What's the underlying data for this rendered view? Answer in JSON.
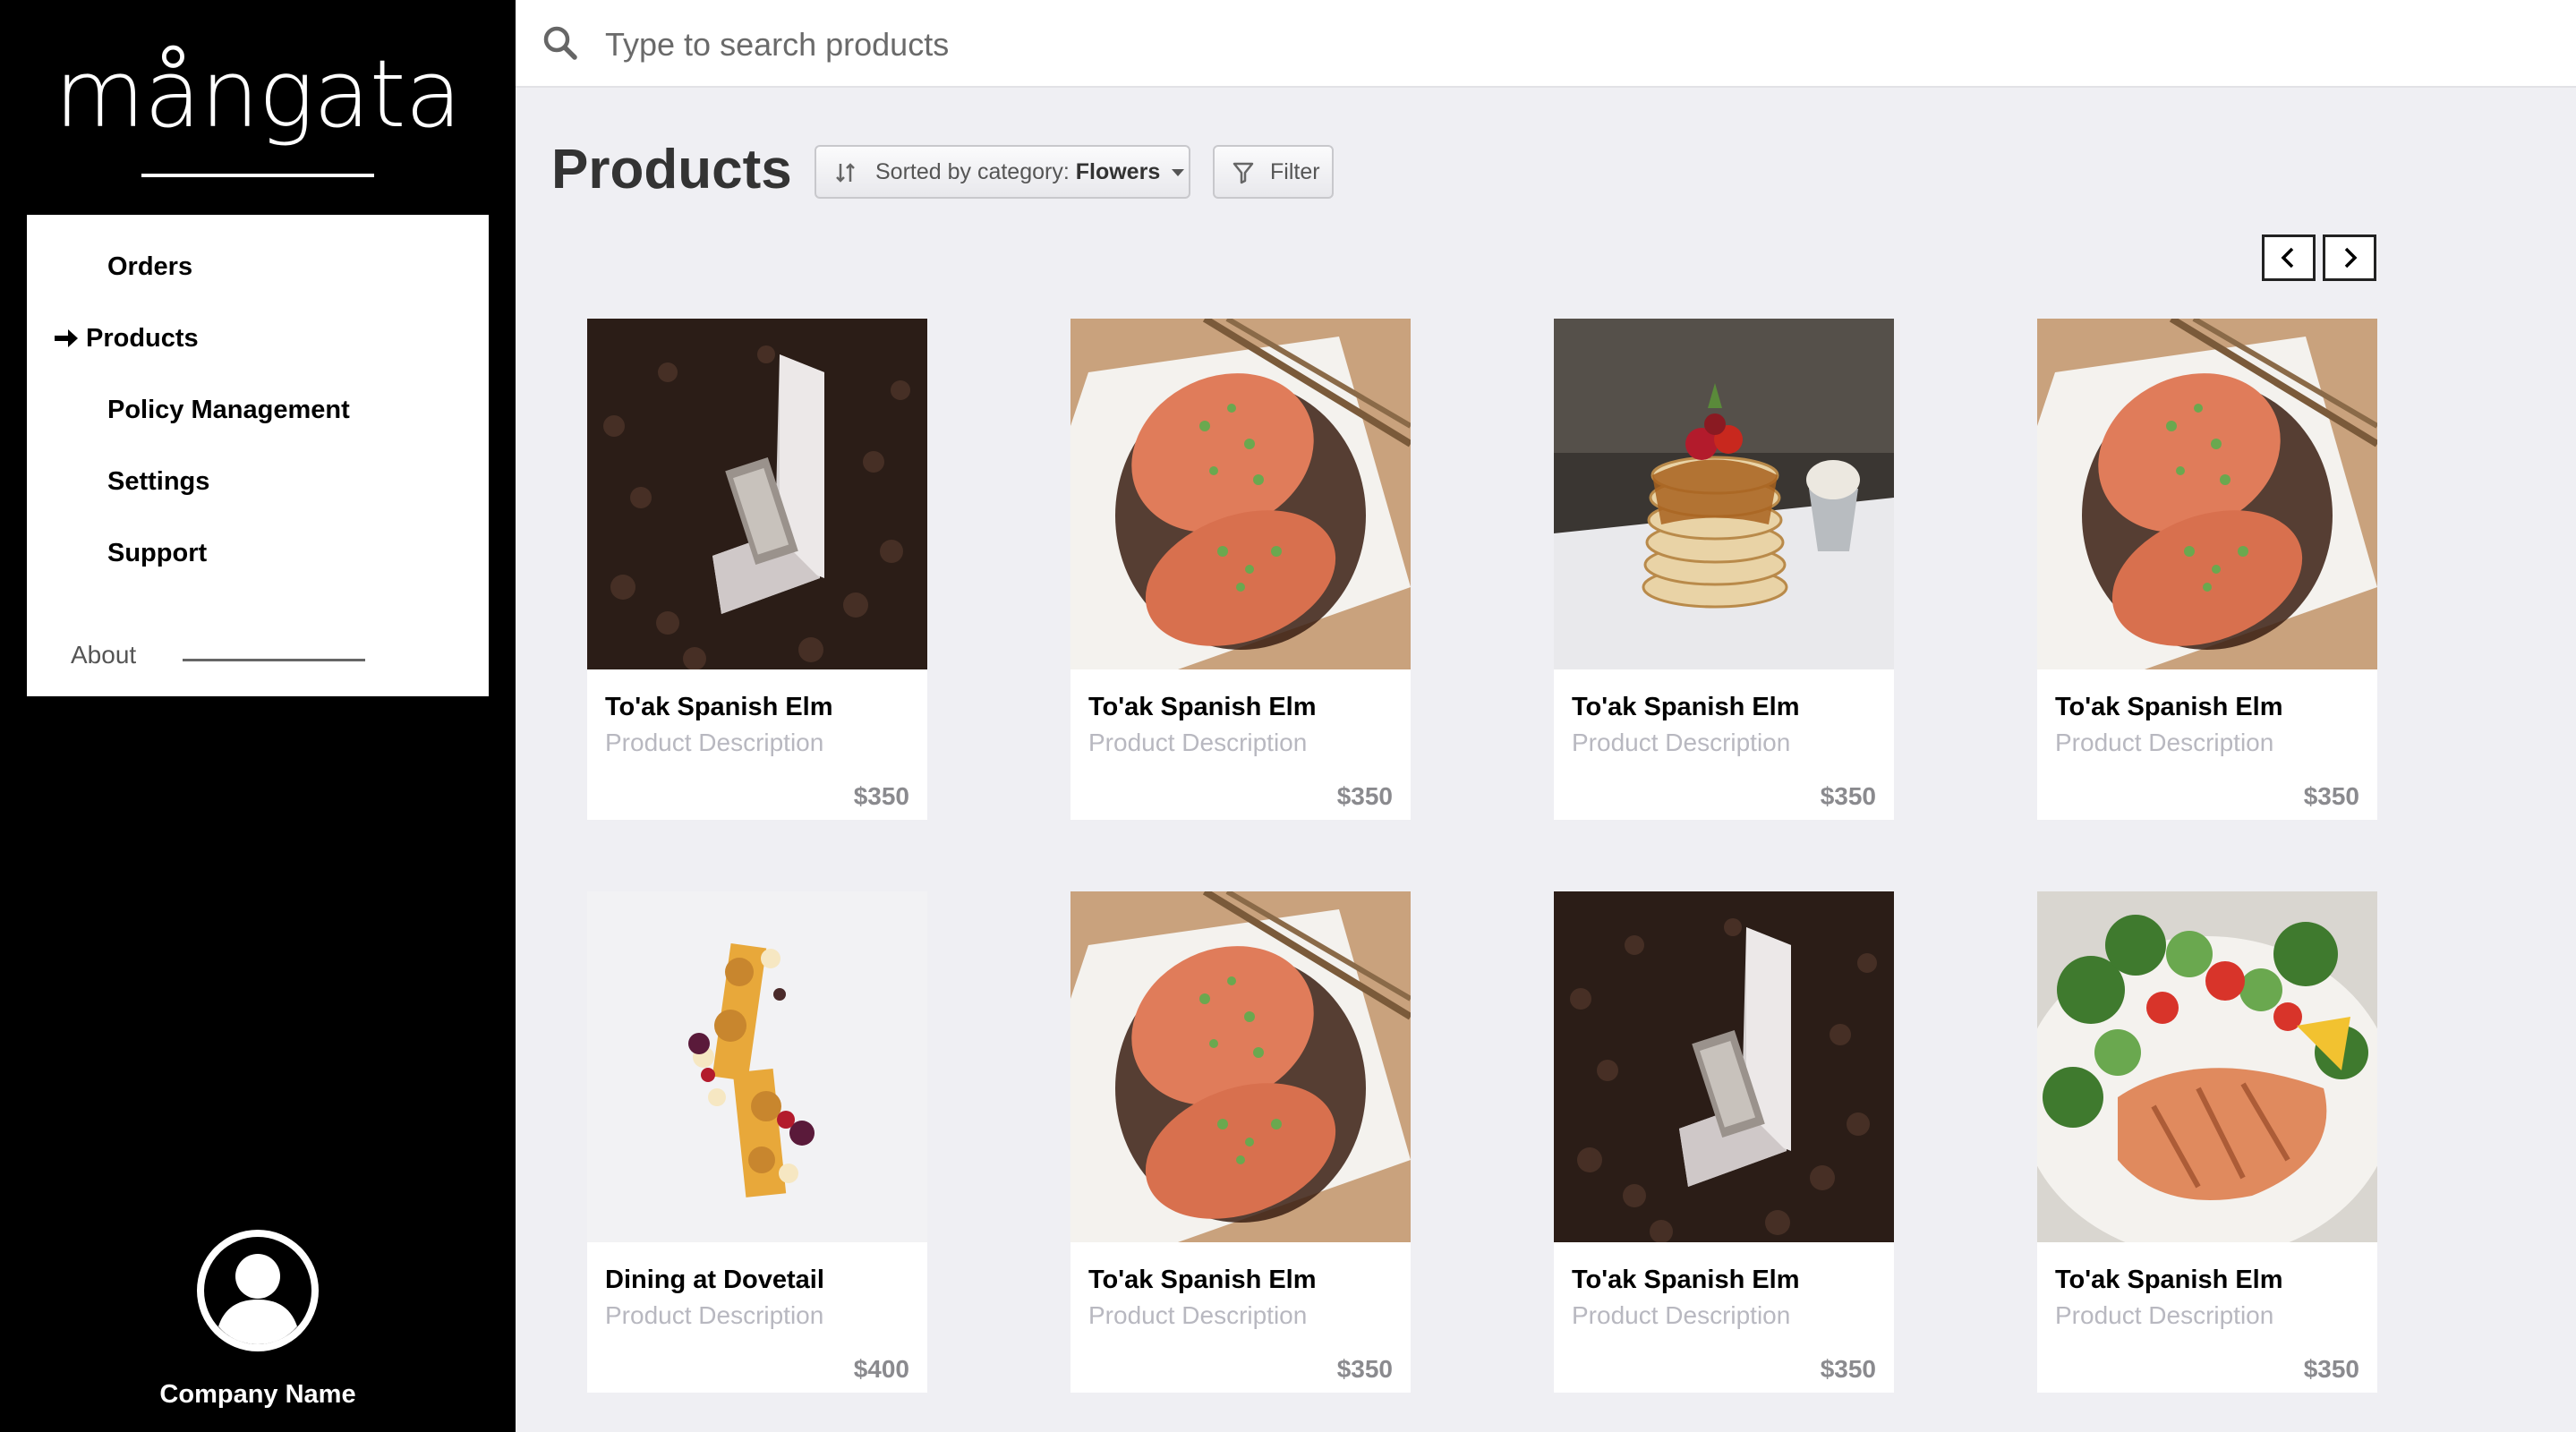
{
  "brand": {
    "logo_text": "mångata"
  },
  "sidebar": {
    "items": [
      {
        "label": "Orders",
        "active": false
      },
      {
        "label": "Products",
        "active": true
      },
      {
        "label": "Policy Management",
        "active": false
      },
      {
        "label": "Settings",
        "active": false
      },
      {
        "label": "Support",
        "active": false
      }
    ],
    "about_label": "About",
    "company_name": "Company Name"
  },
  "search": {
    "placeholder": "Type to search products"
  },
  "main": {
    "title": "Products",
    "sort": {
      "prefix": "Sorted by category:",
      "value": "Flowers"
    },
    "filter_label": "Filter"
  },
  "products": [
    {
      "name": "To'ak Spanish Elm",
      "description": "Product Description",
      "price": "$350",
      "image": "chocolate-box"
    },
    {
      "name": "To'ak Spanish Elm",
      "description": "Product Description",
      "price": "$350",
      "image": "salmon-plate"
    },
    {
      "name": "To'ak Spanish Elm",
      "description": "Product Description",
      "price": "$350",
      "image": "pancake-stack"
    },
    {
      "name": "To'ak Spanish Elm",
      "description": "Product Description",
      "price": "$350",
      "image": "salmon-plate"
    },
    {
      "name": "Dining at Dovetail",
      "description": "Product Description",
      "price": "$400",
      "image": "plated-dessert"
    },
    {
      "name": "To'ak Spanish Elm",
      "description": "Product Description",
      "price": "$350",
      "image": "salmon-plate"
    },
    {
      "name": "To'ak Spanish Elm",
      "description": "Product Description",
      "price": "$350",
      "image": "chocolate-box"
    },
    {
      "name": "To'ak Spanish Elm",
      "description": "Product Description",
      "price": "$350",
      "image": "grilled-salmon-salad"
    }
  ]
}
